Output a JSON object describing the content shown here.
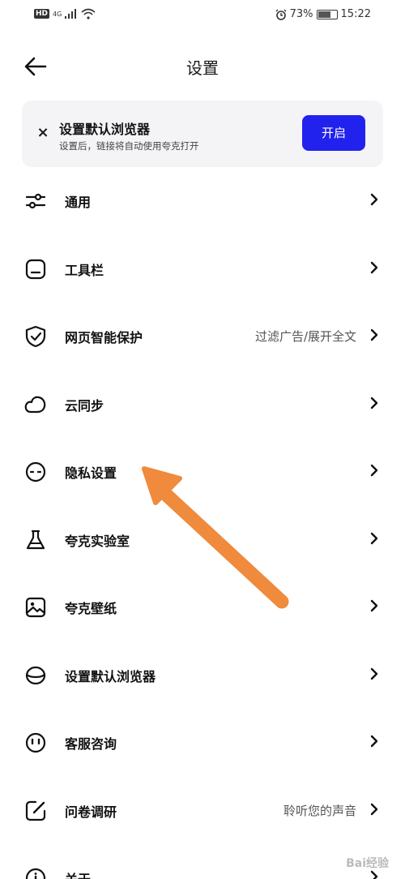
{
  "status_bar": {
    "network": "HD",
    "signal_type": "4G",
    "alarm_icon": "alarm-icon",
    "battery_percent": "73%",
    "battery_level": 0.73,
    "time": "15:22"
  },
  "header": {
    "title": "设置",
    "back_icon": "arrow-left-icon"
  },
  "banner": {
    "title": "设置默认浏览器",
    "subtitle": "设置后，链接将自动使用夸克打开",
    "button_label": "开启",
    "button_color": "#2222ee",
    "close_label": "×"
  },
  "menu": {
    "items": [
      {
        "label": "通用",
        "value": "",
        "icon": "sliders-icon"
      },
      {
        "label": "工具栏",
        "value": "",
        "icon": "toolbar-icon"
      },
      {
        "label": "网页智能保护",
        "value": "过滤广告/展开全文",
        "icon": "shield-check-icon"
      },
      {
        "label": "云同步",
        "value": "",
        "icon": "cloud-icon"
      },
      {
        "label": "隐私设置",
        "value": "",
        "icon": "privacy-face-icon"
      },
      {
        "label": "夸克实验室",
        "value": "",
        "icon": "flask-icon"
      },
      {
        "label": "夸克壁纸",
        "value": "",
        "icon": "wallpaper-icon"
      },
      {
        "label": "设置默认浏览器",
        "value": "",
        "icon": "database-icon"
      },
      {
        "label": "客服咨询",
        "value": "",
        "icon": "smile-face-icon"
      },
      {
        "label": "问卷调研",
        "value": "聆听您的声音",
        "icon": "edit-square-icon"
      },
      {
        "label": "关于",
        "value": "",
        "icon": "info-icon"
      }
    ]
  },
  "annotation": {
    "arrow_color": "#f08a3c"
  },
  "watermark": "Bai经验"
}
